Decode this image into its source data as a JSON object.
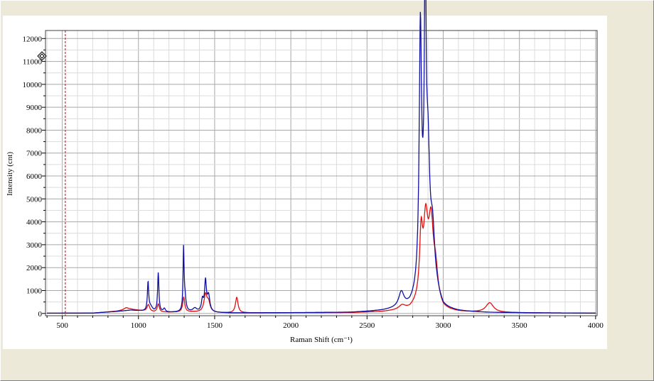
{
  "chart_data": {
    "type": "line",
    "xlabel": "Raman Shift (cm⁻¹)",
    "ylabel": "Intensity (cnt)",
    "xlim": [
      390,
      4010
    ],
    "ylim": [
      -100,
      12350
    ],
    "x_ticks": [
      500,
      1000,
      1500,
      2000,
      2500,
      3000,
      3500,
      4000
    ],
    "y_ticks": [
      0,
      1000,
      2000,
      3000,
      4000,
      5000,
      6000,
      7000,
      8000,
      9000,
      10000,
      11000,
      12000
    ],
    "grid": true,
    "legend": "none",
    "cursor_line_x": 520,
    "series": [
      {
        "color": "#1010a0",
        "baseline": [
          [
            400,
            10
          ],
          [
            700,
            15
          ],
          [
            850,
            80
          ],
          [
            950,
            140
          ],
          [
            1100,
            60
          ],
          [
            1200,
            40
          ],
          [
            1350,
            60
          ],
          [
            1500,
            30
          ],
          [
            1600,
            20
          ],
          [
            2000,
            30
          ],
          [
            2400,
            40
          ],
          [
            2600,
            100
          ],
          [
            2700,
            160
          ],
          [
            2780,
            180
          ],
          [
            2830,
            400
          ],
          [
            2960,
            500
          ],
          [
            3000,
            120
          ],
          [
            3100,
            60
          ],
          [
            3300,
            30
          ],
          [
            4000,
            10
          ]
        ],
        "peaks": [
          {
            "x": 1063,
            "h": 1250,
            "w": 5
          },
          {
            "x": 1080,
            "h": 200,
            "w": 15
          },
          {
            "x": 1130,
            "h": 1700,
            "w": 5
          },
          {
            "x": 1170,
            "h": 150,
            "w": 8
          },
          {
            "x": 1296,
            "h": 2650,
            "w": 4
          },
          {
            "x": 1305,
            "h": 600,
            "w": 8
          },
          {
            "x": 1370,
            "h": 150,
            "w": 15
          },
          {
            "x": 1420,
            "h": 500,
            "w": 8
          },
          {
            "x": 1440,
            "h": 1300,
            "w": 7
          },
          {
            "x": 1460,
            "h": 700,
            "w": 10
          },
          {
            "x": 2725,
            "h": 650,
            "w": 20
          },
          {
            "x": 2850,
            "h": 10500,
            "w": 9
          },
          {
            "x": 2882,
            "h": 11500,
            "w": 7
          },
          {
            "x": 2900,
            "h": 5000,
            "w": 14
          },
          {
            "x": 2930,
            "h": 2500,
            "w": 18
          },
          {
            "x": 2870,
            "h": 2000,
            "w": 25
          }
        ]
      },
      {
        "color": "#e01010",
        "baseline": [
          [
            400,
            10
          ],
          [
            700,
            15
          ],
          [
            850,
            90
          ],
          [
            950,
            170
          ],
          [
            1100,
            60
          ],
          [
            1200,
            50
          ],
          [
            1350,
            60
          ],
          [
            1500,
            30
          ],
          [
            1600,
            20
          ],
          [
            2000,
            30
          ],
          [
            2400,
            30
          ],
          [
            2600,
            60
          ],
          [
            2700,
            100
          ],
          [
            2780,
            120
          ],
          [
            2830,
            300
          ],
          [
            2960,
            400
          ],
          [
            3000,
            100
          ],
          [
            3100,
            50
          ],
          [
            3300,
            30
          ],
          [
            4000,
            10
          ]
        ],
        "peaks": [
          {
            "x": 920,
            "h": 100,
            "w": 20
          },
          {
            "x": 1065,
            "h": 300,
            "w": 10
          },
          {
            "x": 1130,
            "h": 350,
            "w": 8
          },
          {
            "x": 1297,
            "h": 650,
            "w": 8
          },
          {
            "x": 1440,
            "h": 750,
            "w": 12
          },
          {
            "x": 1460,
            "h": 400,
            "w": 12
          },
          {
            "x": 1645,
            "h": 680,
            "w": 10
          },
          {
            "x": 2730,
            "h": 180,
            "w": 25
          },
          {
            "x": 2855,
            "h": 2700,
            "w": 12
          },
          {
            "x": 2885,
            "h": 3200,
            "w": 18
          },
          {
            "x": 2920,
            "h": 3300,
            "w": 20
          },
          {
            "x": 2950,
            "h": 1000,
            "w": 15
          },
          {
            "x": 3305,
            "h": 420,
            "w": 30
          }
        ]
      }
    ]
  }
}
